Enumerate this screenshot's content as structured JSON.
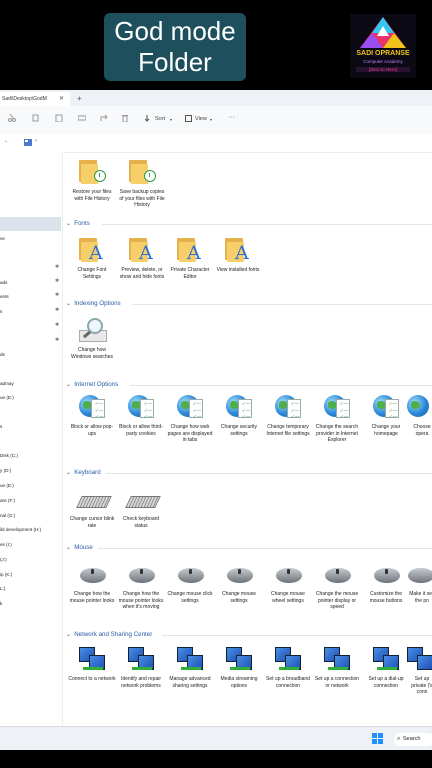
{
  "banner": {
    "title_line1": "God mode",
    "title_line2": "Folder",
    "logo_text1": "SADI OPRANSE",
    "logo_text2": "Computer Academy",
    "logo_text3": "[Zero to Hero]"
  },
  "window": {
    "tab_title": "Sadi\\Desktop\\GodM",
    "tab_close": "✕",
    "tab_new": "+",
    "toolbar": {
      "sort": "Sort",
      "view": "View",
      "more": "···"
    },
    "address": "›"
  },
  "sidebar": {
    "items": [
      "ve",
      "",
      "ads",
      "ents",
      "s",
      "",
      "",
      "ds",
      "admay",
      "ue (E:)",
      "s",
      "Disk (C:)",
      "y (D:)",
      "ue (E:)",
      "are (F:)",
      "nal (G:)",
      "ild development (H:)",
      "es (I:)",
      "(J:)",
      "ip (K:)",
      "L:)",
      "k"
    ]
  },
  "groups": {
    "fonts": "Fonts",
    "indexing": "Indexing Options",
    "internet": "Internet Options",
    "keyboard": "Keyboard",
    "mouse": "Mouse",
    "network": "Network and Sharing Center"
  },
  "file_history": [
    "Restore your files with File History",
    "Save backup copies of your files with File History"
  ],
  "fonts_items": [
    "Change Font Settings",
    "Preview, delete, or show and hide fonts",
    "Private Character Editor",
    "View installed fonts"
  ],
  "indexing_items": [
    "Change how Windows searches"
  ],
  "internet_items": [
    "Block or allow pop-ups",
    "Block or allow third-party cookies",
    "Change how web pages are displayed in tabs",
    "Change security settings",
    "Change temporary Internet file settings",
    "Change the search provider in Internet Explorer",
    "Change your homepage",
    "Choose opera"
  ],
  "keyboard_items": [
    "Change cursor blink rate",
    "Check keyboard status"
  ],
  "mouse_items": [
    "Change how the mouse pointer looks",
    "Change how the mouse pointer looks when it's moving",
    "Change mouse click settings",
    "Change mouse settings",
    "Change mouse wheel settings",
    "Change the mouse pointer display or speed",
    "Customize the mouse buttons",
    "Make it see the po"
  ],
  "network_items": [
    "Connect to a network",
    "Identify and repair network problems",
    "Manage advanced sharing settings",
    "Media streaming options",
    "Set up a broadband connection",
    "Set up a connection or network",
    "Set up a dial-up connection",
    "Set up private (V conn"
  ],
  "taskbar": {
    "search": "Search"
  }
}
